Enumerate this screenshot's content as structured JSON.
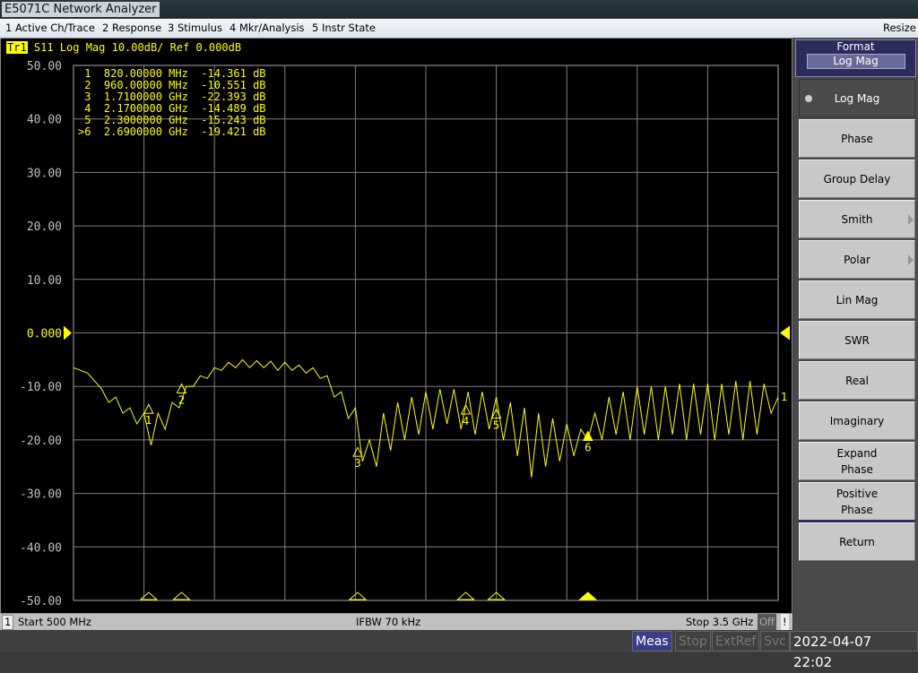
{
  "window": {
    "title": "E5071C Network Analyzer",
    "resize": "Resize"
  },
  "menu": [
    "1 Active Ch/Trace",
    "2 Response",
    "3 Stimulus",
    "4 Mkr/Analysis",
    "5 Instr State"
  ],
  "trace_header": {
    "trace": "Tr1",
    "text": " S11 Log Mag 10.00dB/ Ref 0.000dB"
  },
  "marker_table": [
    {
      "n": " 1",
      "freq": "820.00000 MHz",
      "val": "-14.361 dB"
    },
    {
      "n": " 2",
      "freq": "960.00000 MHz",
      "val": "-10.551 dB"
    },
    {
      "n": " 3",
      "freq": "1.7100000 GHz",
      "val": "-22.393 dB"
    },
    {
      "n": " 4",
      "freq": "2.1700000 GHz",
      "val": "-14.489 dB"
    },
    {
      "n": " 5",
      "freq": "2.3000000 GHz",
      "val": "-15.243 dB"
    },
    {
      "n": ">6",
      "freq": "2.6900000 GHz",
      "val": "-19.421 dB"
    }
  ],
  "softkeys": {
    "title": "Format",
    "current": "Log Mag",
    "items": [
      {
        "label": "Log Mag",
        "selected": true
      },
      {
        "label": "Phase"
      },
      {
        "label": "Group Delay"
      },
      {
        "label": "Smith",
        "submenu": true
      },
      {
        "label": "Polar",
        "submenu": true
      },
      {
        "label": "Lin Mag"
      },
      {
        "label": "SWR"
      },
      {
        "label": "Real"
      },
      {
        "label": "Imaginary"
      },
      {
        "label": "Expand\nPhase"
      },
      {
        "label": "Positive\nPhase"
      }
    ],
    "return": "Return"
  },
  "status": {
    "channel": "1",
    "start": "Start 500 MHz",
    "ifbw": "IFBW 70 kHz",
    "stop": "Stop 3.5 GHz",
    "off": "Off",
    "warn": "!"
  },
  "bottom": {
    "meas": "Meas",
    "stop": "Stop",
    "extref": "ExtRef",
    "svc": "Svc",
    "datetime": "2022-04-07 22:02"
  },
  "colors": {
    "trace": "#ffff00",
    "grid": "#808080",
    "axis_label": "#c0c0c0",
    "active_panel": "#2b2b5e"
  },
  "chart_data": {
    "type": "line",
    "title": "S11 Log Mag 10.00dB/ Ref 0.000dB",
    "xlim": [
      500,
      3500
    ],
    "x_unit": "MHz",
    "ylim": [
      -50,
      50
    ],
    "ref_value": 0,
    "yticks": [
      "50.00",
      "40.00",
      "30.00",
      "20.00",
      "10.00",
      "0.000",
      "-10.00",
      "-20.00",
      "-30.00",
      "-40.00",
      "-50.00"
    ],
    "grid": true,
    "series": [
      {
        "x": [
          500,
          530,
          560,
          590,
          620,
          650,
          680,
          710,
          740,
          770,
          800,
          830,
          860,
          890,
          920,
          950,
          980,
          1010,
          1040,
          1070,
          1100,
          1130,
          1160,
          1190,
          1220,
          1250,
          1280,
          1310,
          1340,
          1370,
          1400,
          1430,
          1460,
          1490,
          1520,
          1550,
          1580,
          1610,
          1640,
          1670,
          1700,
          1730,
          1760,
          1790,
          1820,
          1850,
          1880,
          1910,
          1940,
          1970,
          2000,
          2030,
          2060,
          2090,
          2120,
          2150,
          2180,
          2210,
          2240,
          2270,
          2300,
          2330,
          2360,
          2390,
          2420,
          2450,
          2480,
          2510,
          2540,
          2570,
          2600,
          2630,
          2660,
          2690,
          2720,
          2750,
          2780,
          2810,
          2840,
          2870,
          2900,
          2930,
          2960,
          2990,
          3020,
          3050,
          3080,
          3110,
          3140,
          3170,
          3200,
          3230,
          3260,
          3290,
          3320,
          3350,
          3380,
          3410,
          3440,
          3470,
          3500
        ],
        "y": [
          -6.5,
          -7,
          -7.5,
          -9,
          -10.5,
          -13,
          -12,
          -15,
          -14,
          -17,
          -15,
          -21,
          -15,
          -18,
          -13,
          -14,
          -10,
          -10,
          -8,
          -8.5,
          -6.5,
          -7,
          -5.5,
          -6.5,
          -5,
          -6.5,
          -5.2,
          -6.5,
          -5.3,
          -7,
          -5.5,
          -7,
          -6,
          -7.5,
          -6.5,
          -8.5,
          -8,
          -12,
          -11,
          -16,
          -14,
          -24,
          -20,
          -25,
          -15,
          -22,
          -13,
          -20,
          -12,
          -19,
          -11,
          -18,
          -10.5,
          -17,
          -10.5,
          -18,
          -11,
          -19,
          -11,
          -18,
          -12,
          -20,
          -13,
          -23,
          -14,
          -27,
          -15,
          -25,
          -16,
          -24,
          -17,
          -23,
          -18,
          -20,
          -15,
          -20,
          -12,
          -19,
          -11,
          -20,
          -10,
          -19,
          -10,
          -20,
          -10,
          -19,
          -9.5,
          -20,
          -9.5,
          -19,
          -9.5,
          -20,
          -9.5,
          -19,
          -9,
          -20,
          -9,
          -19,
          -9.5,
          -15,
          -12
        ]
      }
    ],
    "markers": [
      {
        "id": "1",
        "x": 820,
        "y": -14.361
      },
      {
        "id": "2",
        "x": 960,
        "y": -10.551
      },
      {
        "id": "3",
        "x": 1710,
        "y": -22.393
      },
      {
        "id": "4",
        "x": 2170,
        "y": -14.489
      },
      {
        "id": "5",
        "x": 2300,
        "y": -15.243
      },
      {
        "id": "6",
        "x": 2690,
        "y": -19.421,
        "active": true
      }
    ]
  }
}
